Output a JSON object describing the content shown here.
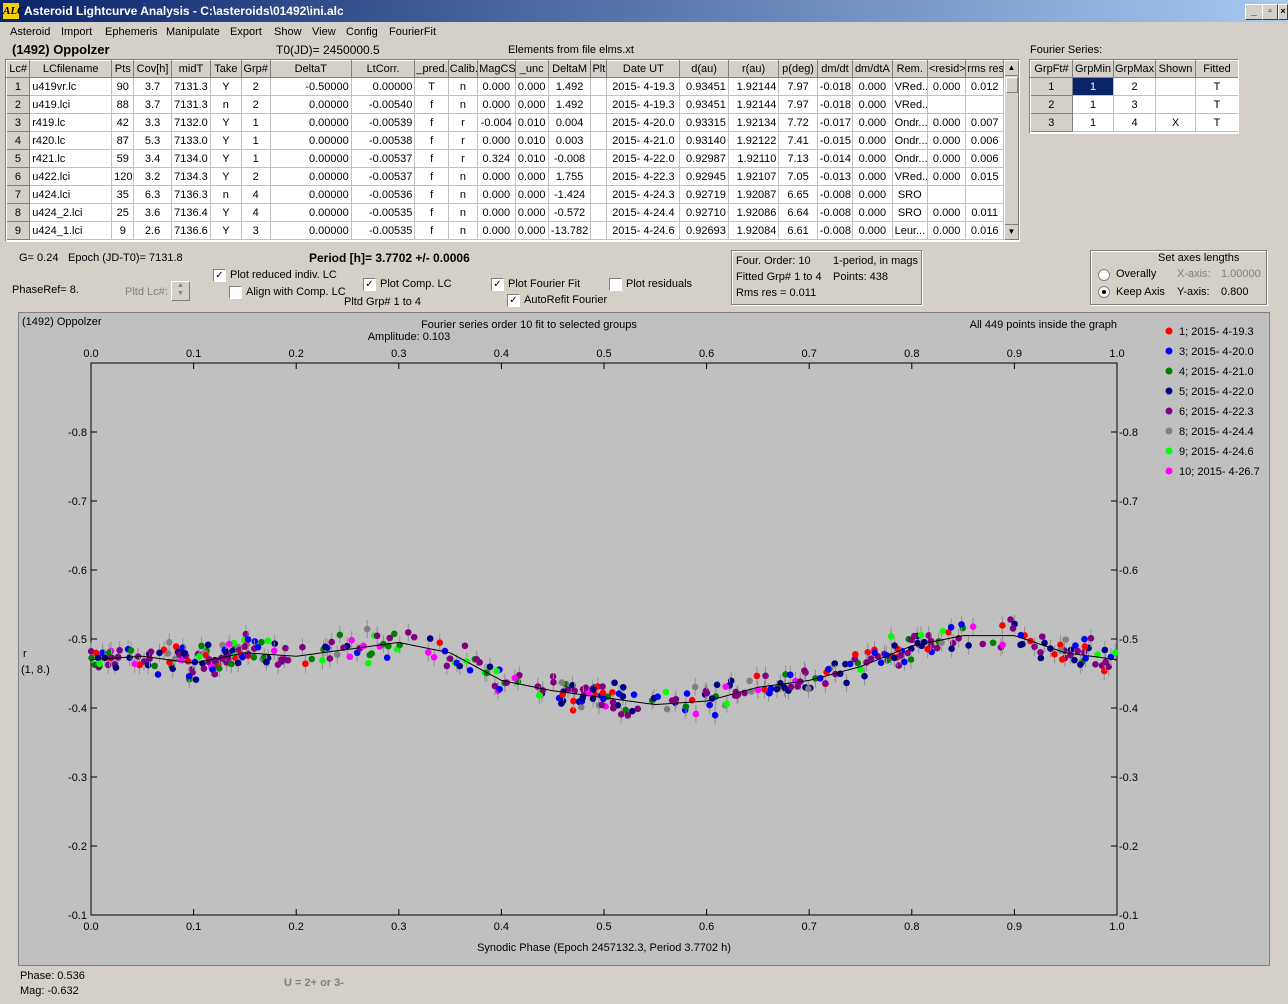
{
  "window": {
    "title": "Asteroid Lightcurve Analysis - C:\\asteroids\\01492\\ini.alc",
    "app_icon": "ALC"
  },
  "menu": [
    "Asteroid",
    "Import",
    "Ephemeris",
    "Manipulate",
    "Export",
    "Show",
    "View",
    "Config",
    "FourierFit"
  ],
  "header": {
    "asteroid": "(1492) Oppolzer",
    "t0": "T0(JD)= 2450000.5",
    "elements": "Elements from file elms.xt"
  },
  "lc_table": {
    "columns": [
      "Lc#",
      "LCfilename",
      "Pts",
      "Cov[h]",
      "midT",
      "Take",
      "Grp#",
      "DeltaT",
      "LtCorr.",
      "_pred.",
      "Calib.",
      "MagCS",
      "_unc",
      "DeltaM",
      "Plt",
      "Date UT",
      "d(au)",
      "r(au)",
      "p(deg)",
      "dm/dt",
      "dm/dtA",
      "Rem.",
      "<resid>",
      "rms res"
    ],
    "rows": [
      [
        "1",
        "u419vr.lc",
        "90",
        "3.7",
        "7131.3",
        "Y",
        "2",
        "-0.50000",
        "0.00000",
        "T",
        "n",
        "0.000",
        "0.000",
        "1.492",
        "",
        "2015- 4-19.3",
        "0.93451",
        "1.92144",
        "7.97",
        "-0.018",
        "0.000",
        "VRed...",
        "0.000",
        "0.012"
      ],
      [
        "2",
        "u419.lci",
        "88",
        "3.7",
        "7131.3",
        "n",
        "2",
        "0.00000",
        "-0.00540",
        "f",
        "n",
        "0.000",
        "0.000",
        "1.492",
        "",
        "2015- 4-19.3",
        "0.93451",
        "1.92144",
        "7.97",
        "-0.018",
        "0.000",
        "VRed...",
        "",
        ""
      ],
      [
        "3",
        "r419.lc",
        "42",
        "3.3",
        "7132.0",
        "Y",
        "1",
        "0.00000",
        "-0.00539",
        "f",
        "r",
        "-0.004",
        "0.010",
        "0.004",
        "",
        "2015- 4-20.0",
        "0.93315",
        "1.92134",
        "7.72",
        "-0.017",
        "0.000",
        "Ondr...",
        "0.000",
        "0.007"
      ],
      [
        "4",
        "r420.lc",
        "87",
        "5.3",
        "7133.0",
        "Y",
        "1",
        "0.00000",
        "-0.00538",
        "f",
        "r",
        "0.000",
        "0.010",
        "0.003",
        "",
        "2015- 4-21.0",
        "0.93140",
        "1.92122",
        "7.41",
        "-0.015",
        "0.000",
        "Ondr...",
        "0.000",
        "0.006"
      ],
      [
        "5",
        "r421.lc",
        "59",
        "3.4",
        "7134.0",
        "Y",
        "1",
        "0.00000",
        "-0.00537",
        "f",
        "r",
        "0.324",
        "0.010",
        "-0.008",
        "",
        "2015- 4-22.0",
        "0.92987",
        "1.92110",
        "7.13",
        "-0.014",
        "0.000",
        "Ondr...",
        "0.000",
        "0.006"
      ],
      [
        "6",
        "u422.lci",
        "120",
        "3.2",
        "7134.3",
        "Y",
        "2",
        "0.00000",
        "-0.00537",
        "f",
        "n",
        "0.000",
        "0.000",
        "1.755",
        "",
        "2015- 4-22.3",
        "0.92945",
        "1.92107",
        "7.05",
        "-0.013",
        "0.000",
        "VRed...",
        "0.000",
        "0.015"
      ],
      [
        "7",
        "u424.lci",
        "35",
        "6.3",
        "7136.3",
        "n",
        "4",
        "0.00000",
        "-0.00536",
        "f",
        "n",
        "0.000",
        "0.000",
        "-1.424",
        "",
        "2015- 4-24.3",
        "0.92719",
        "1.92087",
        "6.65",
        "-0.008",
        "0.000",
        "SRO",
        "",
        ""
      ],
      [
        "8",
        "u424_2.lci",
        "25",
        "3.6",
        "7136.4",
        "Y",
        "4",
        "0.00000",
        "-0.00535",
        "f",
        "n",
        "0.000",
        "0.000",
        "-0.572",
        "",
        "2015- 4-24.4",
        "0.92710",
        "1.92086",
        "6.64",
        "-0.008",
        "0.000",
        "SRO",
        "0.000",
        "0.011"
      ],
      [
        "9",
        "u424_1.lci",
        "9",
        "2.6",
        "7136.6",
        "Y",
        "3",
        "0.00000",
        "-0.00535",
        "f",
        "n",
        "0.000",
        "0.000",
        "-13.782",
        "",
        "2015- 4-24.6",
        "0.92693",
        "1.92084",
        "6.61",
        "-0.008",
        "0.000",
        "Leur...",
        "0.000",
        "0.016"
      ]
    ]
  },
  "fourier_table": {
    "label": "Fourier Series:",
    "columns": [
      "GrpFt#",
      "GrpMin",
      "GrpMax",
      "Shown",
      "Fitted"
    ],
    "rows": [
      [
        "1",
        "1",
        "2",
        "",
        "T"
      ],
      [
        "2",
        "1",
        "3",
        "",
        "T"
      ],
      [
        "3",
        "1",
        "4",
        "X",
        "T"
      ]
    ]
  },
  "controls": {
    "g": "G= 0.24",
    "epoch": "Epoch (JD-T0)= 7131.8",
    "period": "Period [h]= 3.7702 +/- 0.0006",
    "phaseref": "PhaseRef= 8.",
    "pltd_lc": "Pltd Lc#:",
    "plot_reduced": "Plot reduced indiv. LC",
    "align_comp": "Align with Comp. LC",
    "plot_comp": "Plot Comp. LC",
    "pltd_grp": "Pltd Grp#  1  to  4",
    "plot_fourier": "Plot Fourier Fit",
    "autorefit": "AutoRefit Fourier",
    "plot_residuals": "Plot residuals",
    "four_order": "Four. Order: 10",
    "period_mags": "1-period, in mags",
    "fitted_grp": "Fitted Grp# 1 to 4",
    "points": "Points: 438",
    "rms_res": "Rms res     = 0.011",
    "axes_title": "Set axes lengths",
    "overally": "Overally",
    "keep_axis": "Keep Axis",
    "xaxis_label": "X-axis:",
    "xaxis_val": "1.00000",
    "yaxis_label": "Y-axis:",
    "yaxis_val": "0.800"
  },
  "status": {
    "phase": "Phase:  0.536",
    "mag": "Mag:   -0.632",
    "hint": "U = 2+ or 3-"
  },
  "chart_data": {
    "type": "scatter",
    "title": "Fourier series order 10 fit to selected groups",
    "subtitle": "Amplitude: 0.103",
    "corner_left": "(1492) Oppolzer",
    "corner_right": "All 449 points inside the graph",
    "xlabel": "Synodic Phase (Epoch 2457132.3, Period 3.7702 h)",
    "ylabel": "r\n(1, 8.)",
    "xlim": [
      0,
      1
    ],
    "ylim": [
      -0.9,
      -0.1
    ],
    "xticks": [
      "0.0",
      "0.1",
      "0.2",
      "0.3",
      "0.4",
      "0.5",
      "0.6",
      "0.7",
      "0.8",
      "0.9",
      "1.0"
    ],
    "yticks": [
      "-0.8",
      "-0.7",
      "-0.6",
      "-0.5",
      "-0.4",
      "-0.3",
      "-0.2",
      "-0.1"
    ],
    "series": [
      {
        "name": "1; 2015- 4-19.3",
        "color": "#ff0000"
      },
      {
        "name": "3; 2015- 4-20.0",
        "color": "#0000ff"
      },
      {
        "name": "4; 2015- 4-21.0",
        "color": "#008000"
      },
      {
        "name": "5; 2015- 4-22.0",
        "color": "#000080"
      },
      {
        "name": "6; 2015- 4-22.3",
        "color": "#800080"
      },
      {
        "name": "8; 2015- 4-24.4",
        "color": "#808080"
      },
      {
        "name": "9; 2015- 4-24.6",
        "color": "#00ff00"
      },
      {
        "name": "10; 2015- 4-26.7",
        "color": "#ff00ff"
      }
    ],
    "fit_curve": {
      "x": [
        0,
        0.05,
        0.1,
        0.15,
        0.2,
        0.25,
        0.3,
        0.35,
        0.4,
        0.45,
        0.5,
        0.55,
        0.6,
        0.65,
        0.7,
        0.75,
        0.8,
        0.85,
        0.9,
        0.95,
        1.0
      ],
      "y": [
        -0.47,
        -0.475,
        -0.465,
        -0.48,
        -0.475,
        -0.485,
        -0.495,
        -0.48,
        -0.44,
        -0.425,
        -0.415,
        -0.405,
        -0.41,
        -0.43,
        -0.44,
        -0.46,
        -0.49,
        -0.505,
        -0.505,
        -0.48,
        -0.47
      ]
    }
  }
}
